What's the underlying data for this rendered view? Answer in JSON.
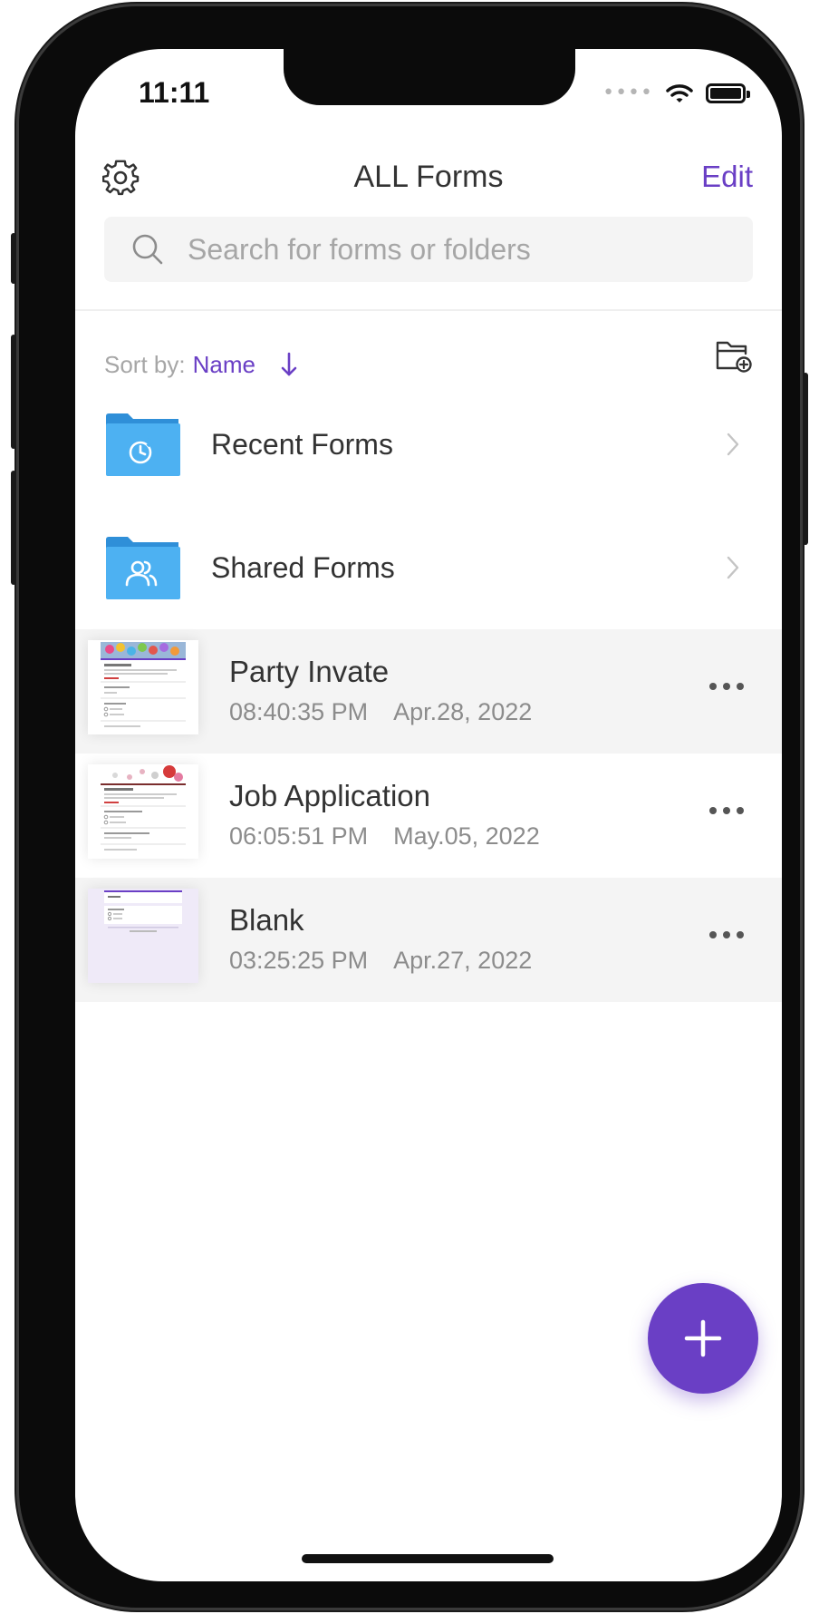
{
  "status": {
    "time": "11:11"
  },
  "header": {
    "title": "ALL Forms",
    "edit_label": "Edit"
  },
  "search": {
    "placeholder": "Search for forms or folders",
    "value": ""
  },
  "sort": {
    "label": "Sort by:",
    "value": "Name"
  },
  "folders": [
    {
      "label": "Recent Forms",
      "icon": "clock-icon"
    },
    {
      "label": "Shared Forms",
      "icon": "users-icon"
    }
  ],
  "forms": [
    {
      "name": "Party Invate",
      "time": "08:40:35 PM",
      "date": "Apr.28, 2022"
    },
    {
      "name": "Job Application",
      "time": "06:05:51 PM",
      "date": "May.05, 2022"
    },
    {
      "name": "Blank",
      "time": "03:25:25 PM",
      "date": "Apr.27, 2022"
    }
  ],
  "colors": {
    "accent": "#6a3fc5",
    "folder": "#4db1f2",
    "row_alt": "#f4f4f4"
  }
}
